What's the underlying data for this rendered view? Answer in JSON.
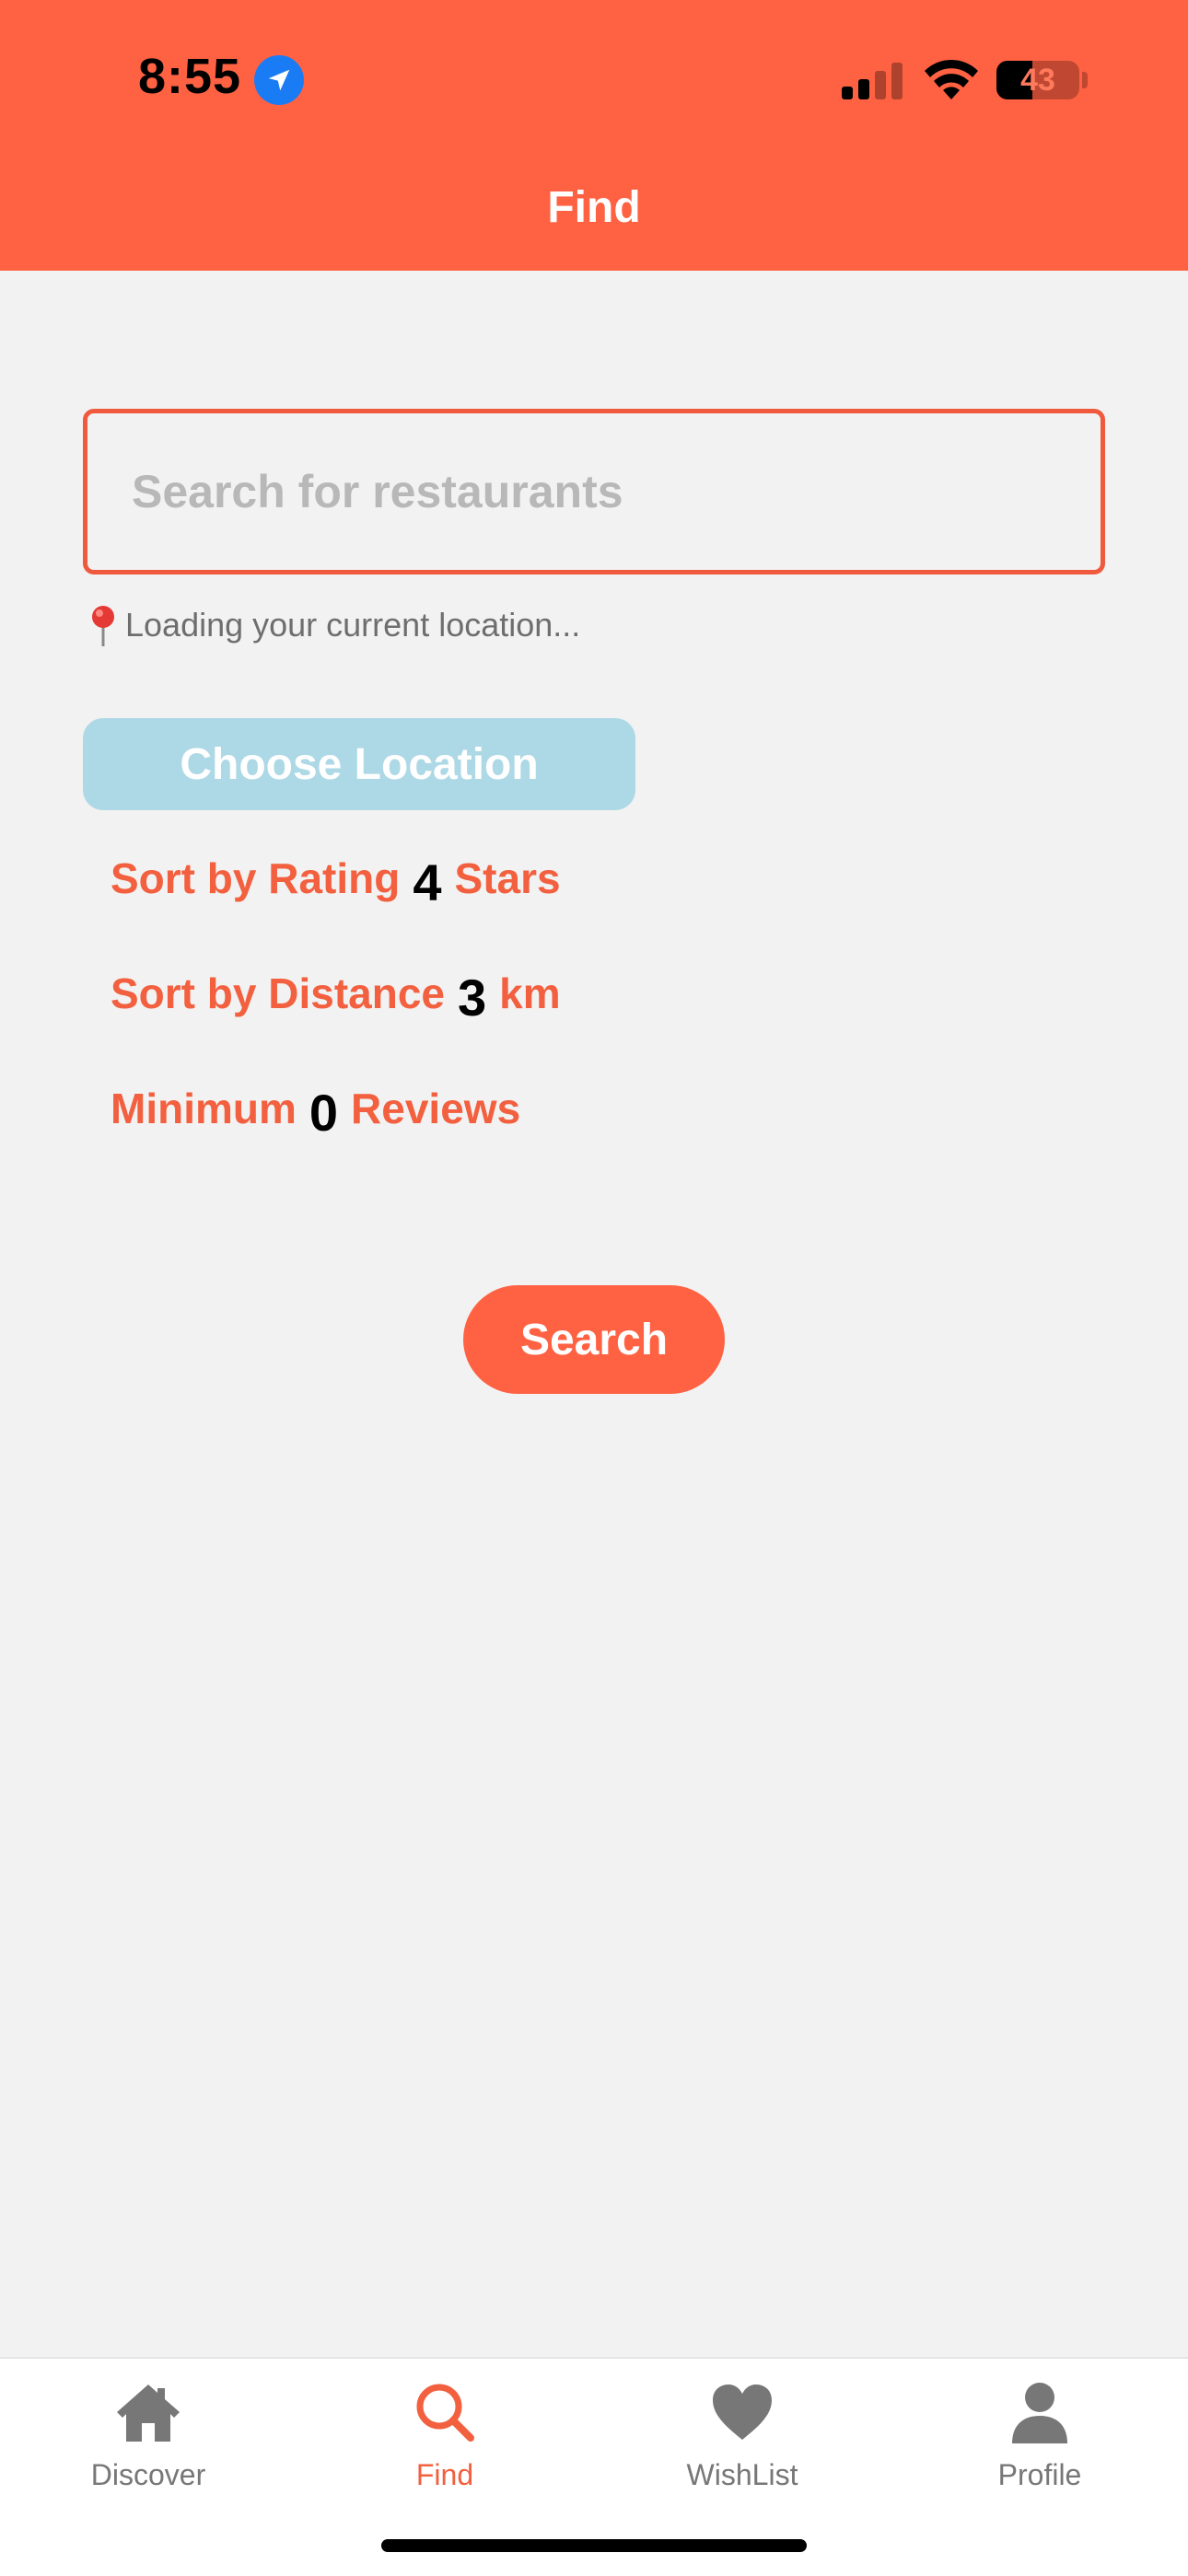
{
  "status_bar": {
    "time": "8:55",
    "battery_level": "43",
    "battery_fraction": 0.43
  },
  "header": {
    "title": "Find"
  },
  "search": {
    "placeholder": "Search for restaurants",
    "value": ""
  },
  "location_status": "Loading your current location...",
  "choose_location_label": "Choose Location",
  "filters": {
    "rating": {
      "prefix": "Sort by Rating",
      "value": "4",
      "suffix": "Stars"
    },
    "distance": {
      "prefix": "Sort by Distance",
      "value": "3",
      "suffix": "km"
    },
    "reviews": {
      "prefix": "Minimum",
      "value": "0",
      "suffix": "Reviews"
    }
  },
  "search_button_label": "Search",
  "tabs": [
    {
      "label": "Discover",
      "icon": "house-icon",
      "active": false
    },
    {
      "label": "Find",
      "icon": "magnifier-icon",
      "active": true
    },
    {
      "label": "WishList",
      "icon": "heart-icon",
      "active": false
    },
    {
      "label": "Profile",
      "icon": "person-icon",
      "active": false
    }
  ],
  "colors": {
    "accent": "#ff6243",
    "choose_location_bg": "#add8e6",
    "inactive_tab": "#777777",
    "background": "#f2f2f2"
  }
}
